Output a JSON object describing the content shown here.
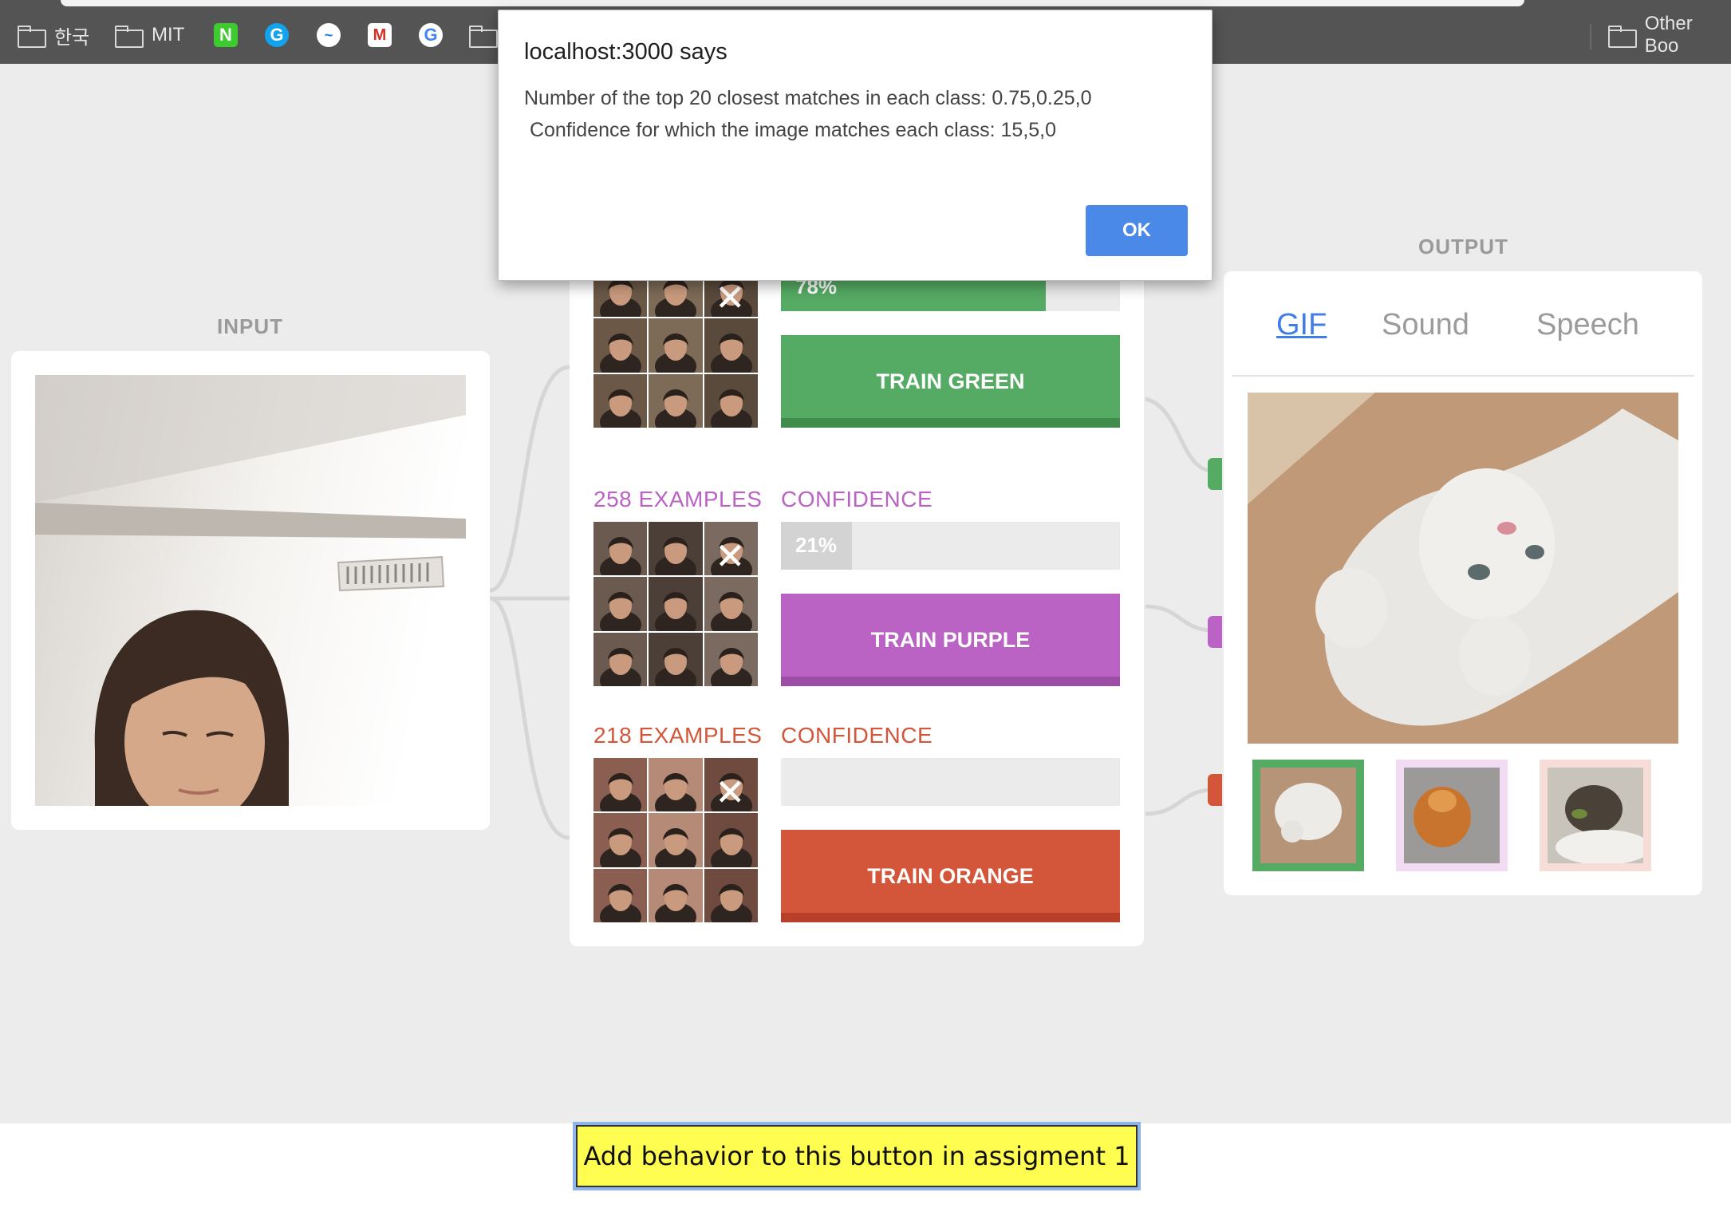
{
  "bookmarks_bar": {
    "items": [
      {
        "type": "folder",
        "label": "한국"
      },
      {
        "type": "folder",
        "label": "MIT"
      },
      {
        "type": "favicon",
        "icon": "naver-icon",
        "glyph": "N"
      },
      {
        "type": "favicon",
        "icon": "grammarly-icon",
        "glyph": "G"
      },
      {
        "type": "favicon",
        "icon": "messenger-icon",
        "glyph": "~"
      },
      {
        "type": "favicon",
        "icon": "gmail-icon",
        "glyph": "M"
      },
      {
        "type": "favicon",
        "icon": "google-icon",
        "glyph": "G"
      },
      {
        "type": "folder",
        "label": ""
      }
    ],
    "other_bookmarks": "Other Boo"
  },
  "input": {
    "title": "INPUT"
  },
  "classes": [
    {
      "id": "green",
      "examples_label": "",
      "confidence_label": "",
      "confidence": 0.78,
      "confidence_text": "78%",
      "train_label": "TRAIN GREEN",
      "color": "#55aa64",
      "shade": "#3f8c4d",
      "fill": "#55aa64"
    },
    {
      "id": "purple",
      "examples_label": "258 EXAMPLES",
      "confidence_label": "CONFIDENCE",
      "confidence": 0.21,
      "confidence_text": "21%",
      "train_label": "TRAIN PURPLE",
      "color": "#bb63c5",
      "shade": "#9c4ea6",
      "fill": "#d3d3d3"
    },
    {
      "id": "orange",
      "examples_label": "218 EXAMPLES",
      "confidence_label": "CONFIDENCE",
      "confidence": 0,
      "confidence_text": "",
      "train_label": "TRAIN ORANGE",
      "color": "#d4563a",
      "shade": "#b8402b",
      "fill": "#d4563a"
    }
  ],
  "output": {
    "title": "OUTPUT",
    "tabs": [
      {
        "label": "GIF",
        "active": true
      },
      {
        "label": "Sound",
        "active": false
      },
      {
        "label": "Speech",
        "active": false
      }
    ],
    "thumb_borders": [
      "#55aa64",
      "#f1dcf3",
      "#f7ddd7"
    ]
  },
  "assignment_button": "Add behavior to this button in assigment 1",
  "dialog": {
    "title": "localhost:3000 says",
    "line1": "Number of the top 20 closest matches in each class: 0.75,0.25,0",
    "line2": " Confidence for which the image matches each class: 15,5,0",
    "ok_label": "OK"
  }
}
